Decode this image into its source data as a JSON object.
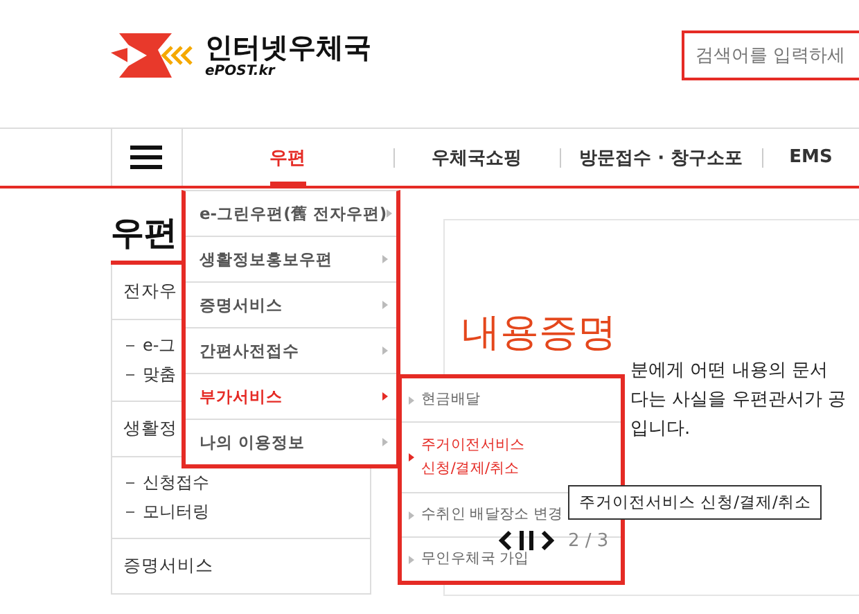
{
  "header": {
    "logo": {
      "name": "인터넷우체국",
      "subtitle": "ePOST.kr"
    },
    "search": {
      "placeholder": "검색어를 입력하세"
    }
  },
  "nav": {
    "tabs": [
      {
        "label": "우편",
        "selected": true
      },
      {
        "label": "우체국쇼핑",
        "selected": false
      },
      {
        "label": "방문접수 · 창구소포",
        "selected": false
      },
      {
        "label": "EMS",
        "selected": false
      }
    ]
  },
  "sidebar": {
    "title": "우편",
    "sections": [
      {
        "label": "전자우",
        "children": [
          {
            "label": "e-그"
          },
          {
            "label": "맞춤"
          }
        ]
      },
      {
        "label": "생활정",
        "children": [
          {
            "label": "신청접수"
          },
          {
            "label": "모니터링"
          }
        ]
      },
      {
        "label": "증명서비스"
      }
    ]
  },
  "dropdown": {
    "items": [
      {
        "label": "e-그린우편(舊 전자우편)",
        "selected": false
      },
      {
        "label": "생활정보홍보우편",
        "selected": false
      },
      {
        "label": "증명서비스",
        "selected": false
      },
      {
        "label": "간편사전접수",
        "selected": false
      },
      {
        "label": "부가서비스",
        "selected": true
      },
      {
        "label": "나의 이용정보",
        "selected": false
      }
    ]
  },
  "submenu": {
    "items": [
      {
        "label": "현금배달",
        "selected": false
      },
      {
        "label": "주거이전서비스\n신청/결제/취소",
        "selected": true
      },
      {
        "label": "수취인 배달장소 변경",
        "selected": false
      },
      {
        "label": "무인우체국 가입",
        "selected": false
      }
    ]
  },
  "content": {
    "title": "내용증명",
    "paragraph_lines": [
      "분에게 어떤 내용의 문서",
      "다는 사실을 우편관서가 공",
      "입니다."
    ]
  },
  "tooltip": {
    "text": "주거이전서비스 신청/결제/취소"
  },
  "carousel": {
    "page": "2 / 3"
  }
}
